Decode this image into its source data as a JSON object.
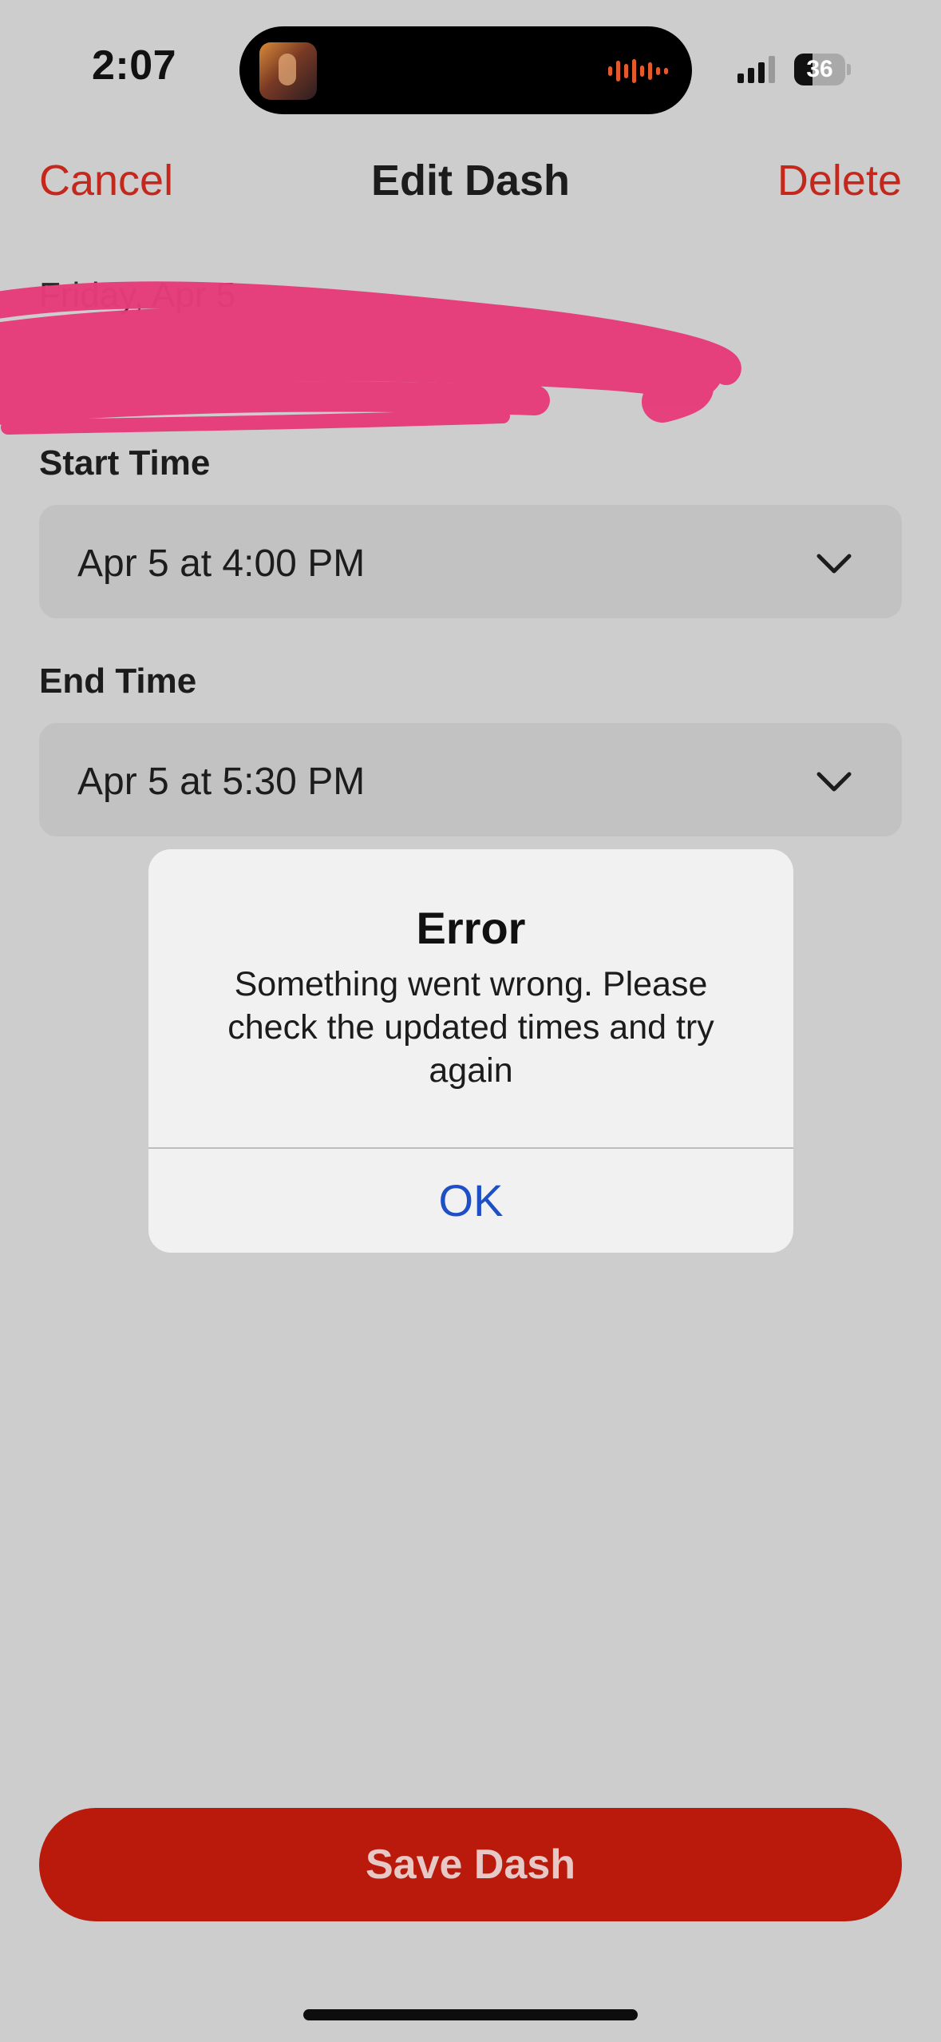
{
  "status_bar": {
    "time": "2:07",
    "battery": "36"
  },
  "nav": {
    "cancel": "Cancel",
    "title": "Edit Dash",
    "delete": "Delete"
  },
  "date_label": "Friday, Apr 5",
  "start": {
    "label": "Start Time",
    "value": "Apr 5 at 4:00 PM"
  },
  "end": {
    "label": "End Time",
    "value": "Apr 5 at 5:30 PM"
  },
  "alert": {
    "title": "Error",
    "message": "Something went wrong. Please check the updated times and try again",
    "ok": "OK"
  },
  "save_button": "Save Dash",
  "colors": {
    "accent": "#c4281c",
    "save_bg": "#ba1a0c",
    "scribble": "#e63b7a",
    "link_blue": "#1f4fc7"
  },
  "icons": {
    "chevron": "chevron-down-icon",
    "signal": "cellular-signal-icon",
    "battery": "battery-icon",
    "audio": "audio-waveform-icon"
  }
}
